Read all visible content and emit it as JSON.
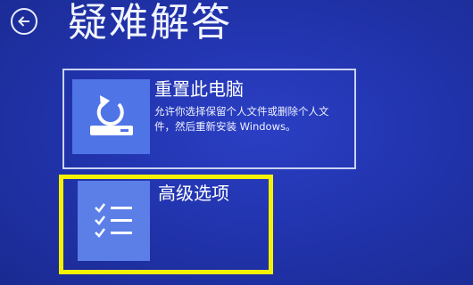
{
  "header": {
    "back_icon": "back-arrow-icon",
    "title": "疑难解答"
  },
  "options": [
    {
      "icon": "reset-pc-icon",
      "title": "重置此电脑",
      "description": "允许你选择保留个人文件或删除个人文件，然后重新安装 Windows。"
    },
    {
      "icon": "checklist-icon",
      "title": "高级选项",
      "highlighted": true
    }
  ],
  "colors": {
    "background": "#2234ae",
    "tile_icon_background": "#4f74e6",
    "highlight_border": "#f4f200"
  }
}
